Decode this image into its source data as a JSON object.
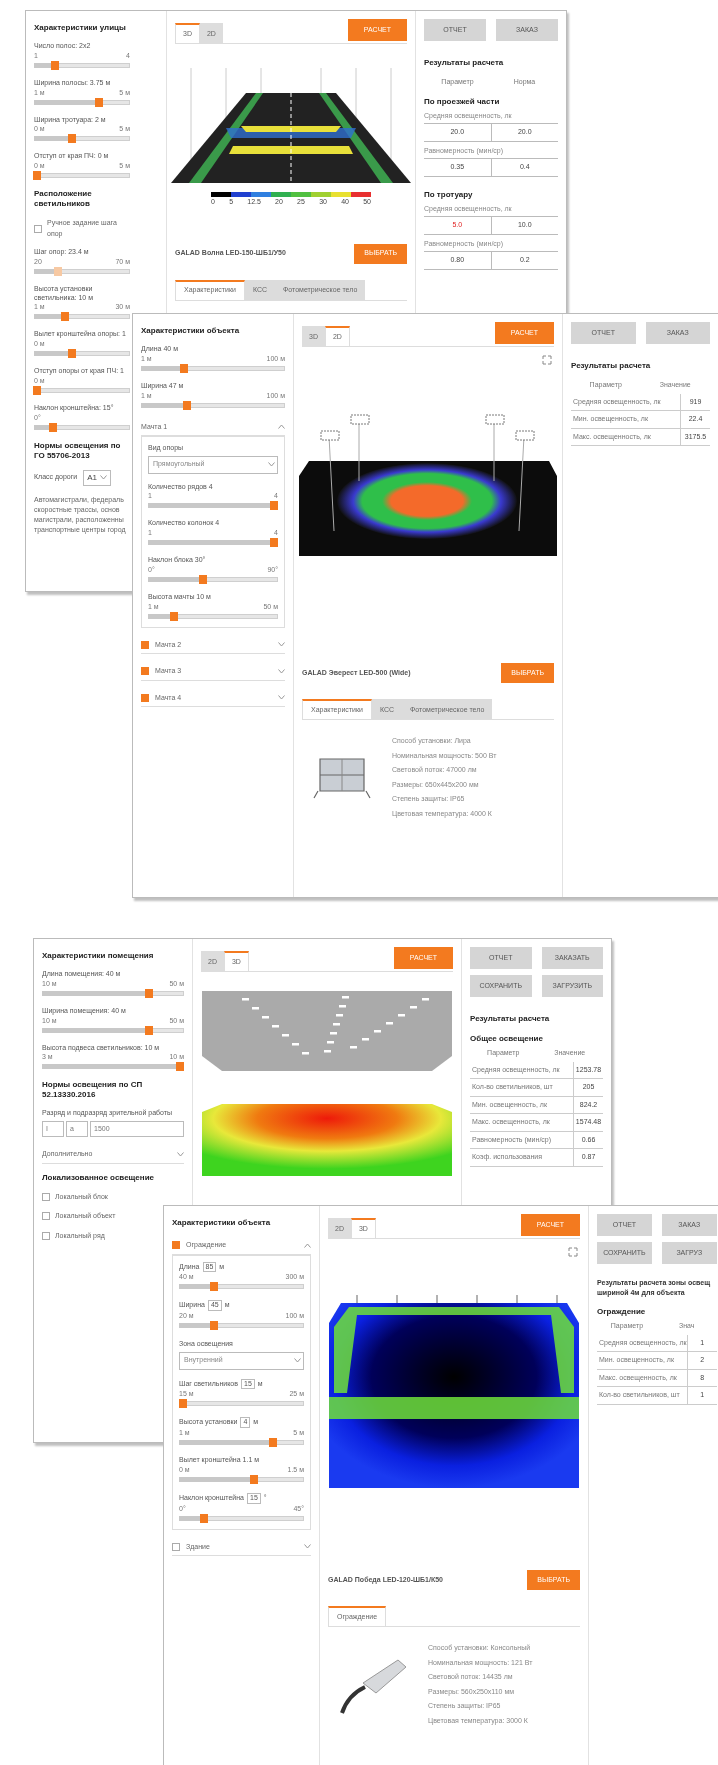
{
  "panels": [
    {
      "left": [
        {
          "kind": "heading",
          "text": "Характеристики улицы"
        },
        {
          "kind": "slider",
          "label": "Число полос: 2х2",
          "min": "1",
          "max": "4",
          "level": 0.22,
          "disabled": false
        },
        {
          "kind": "slider",
          "label": "Ширина полосы: 3.75 м",
          "min": "1 м",
          "max": "5 м",
          "level": 0.68,
          "disabled": false
        },
        {
          "kind": "slider",
          "label": "Ширина тротуара: 2 м",
          "min": "0 м",
          "max": "5 м",
          "level": 0.4,
          "disabled": false
        },
        {
          "kind": "slider",
          "label": "Отступ от края ПЧ: 0 м",
          "min": "0 м",
          "max": "5 м",
          "level": 0.03,
          "disabled": false
        },
        {
          "kind": "heading",
          "text": "Расположение светильников"
        },
        {
          "kind": "checkbox",
          "label": "Ручное задание шага опор",
          "checked": false
        },
        {
          "kind": "slider",
          "label": "Шаг опор: 23.4 м",
          "min": "20",
          "max": "70 м",
          "level": 0.25,
          "disabled": true
        },
        {
          "kind": "slider",
          "label": "Высота установки светильника: 10 м",
          "min": "1 м",
          "max": "30 м",
          "level": 0.32,
          "disabled": false
        },
        {
          "kind": "slider",
          "label": "Вылет кронштейна опоры: 1",
          "min": "0 м",
          "level": 0.4,
          "disabled": false
        },
        {
          "kind": "slider",
          "label": "Отступ опоры от края ПЧ: 1",
          "min": "0 м",
          "level": 0.03,
          "disabled": false
        },
        {
          "kind": "slider",
          "label": "Наклон кронштейна: 15°",
          "min": "0°",
          "level": 0.2,
          "disabled": false
        },
        {
          "kind": "heading",
          "text": "Нормы освещения по ГО 55706-2013"
        },
        {
          "kind": "select-inline",
          "label": "Класс дороги",
          "value": "А1"
        },
        {
          "kind": "text",
          "lines": [
            "Автомагистрали, федераль",
            "скоростные трассы, основ",
            "магистрали, расположенны",
            "транспортные центры город"
          ]
        }
      ],
      "center": {
        "view_tabs": [
          {
            "label": "3D",
            "selected": true
          },
          {
            "label": "2D",
            "selected": false
          }
        ],
        "calc_button": "РАСЧЕТ",
        "visual": {
          "kind": "road"
        },
        "scale": [
          "0",
          "5",
          "12.5",
          "20",
          "25",
          "30",
          "40",
          "50"
        ],
        "product": "GALAD Волна LED-150-ШБ1/У50",
        "select_button": "ВЫБРАТЬ",
        "info_tabs": [
          {
            "label": "Характеристики",
            "selected": true
          },
          {
            "label": "КСС",
            "selected": false
          },
          {
            "label": "Фотометрическое тело",
            "selected": false
          }
        ]
      },
      "right": {
        "buttons": [
          "ОТЧЕТ",
          "ЗАКАЗ"
        ],
        "title": "Результаты расчета",
        "header": [
          "Параметр",
          "Норма"
        ],
        "sections": [
          {
            "title": "По проезжей части",
            "rows": [
              {
                "kind": "pair",
                "label": "Средняя освещенность, лк",
                "values": [
                  {
                    "text": "20.0",
                    "alert": false
                  },
                  {
                    "text": "20.0",
                    "alert": false
                  }
                ]
              },
              {
                "kind": "pair",
                "label": "Равномерность (мин/ср)",
                "values": [
                  {
                    "text": "0.35",
                    "alert": false
                  },
                  {
                    "text": "0.4",
                    "alert": false
                  }
                ]
              }
            ]
          },
          {
            "title": "По тротуару",
            "rows": [
              {
                "kind": "pair",
                "label": "Средняя освещенность, лк",
                "values": [
                  {
                    "text": "5.0",
                    "alert": true
                  },
                  {
                    "text": "10.0",
                    "alert": false
                  }
                ]
              },
              {
                "kind": "pair",
                "label": "Равномерность (мин/ср)",
                "values": [
                  {
                    "text": "0.80",
                    "alert": false
                  },
                  {
                    "text": "0.2",
                    "alert": false
                  }
                ]
              }
            ]
          }
        ]
      }
    },
    {
      "left": [
        {
          "kind": "heading",
          "text": "Характеристики объекта"
        },
        {
          "kind": "slider",
          "label": "Длина 40 м",
          "min": "1 м",
          "max": "100 м",
          "level": 0.3
        },
        {
          "kind": "slider",
          "label": "Ширина 47 м",
          "min": "1 м",
          "max": "100 м",
          "level": 0.32
        },
        {
          "kind": "section",
          "label": "Мачта 1",
          "expanded": true,
          "children": [
            {
              "kind": "select",
              "label": "Вид опоры",
              "value": "Прямоугольный"
            },
            {
              "kind": "slider",
              "label": "Количество рядов 4",
              "min": "1",
              "max": "4",
              "level": 0.97
            },
            {
              "kind": "slider",
              "label": "Количество колонок 4",
              "min": "1",
              "max": "4",
              "level": 0.97
            },
            {
              "kind": "slider",
              "label": "Наклон блока 30°",
              "min": "0°",
              "max": "90°",
              "level": 0.42
            },
            {
              "kind": "slider",
              "label": "Высота мачты 10 м",
              "min": "1 м",
              "max": "50 м",
              "level": 0.2
            }
          ]
        },
        {
          "kind": "section",
          "label": "Мачта 2",
          "checked": true,
          "expanded": false
        },
        {
          "kind": "section",
          "label": "Мачта 3",
          "checked": true,
          "expanded": false
        },
        {
          "kind": "section",
          "label": "Мачта 4",
          "checked": true,
          "expanded": false
        }
      ],
      "center": {
        "view_tabs": [
          {
            "label": "3D",
            "selected": false
          },
          {
            "label": "2D",
            "selected": true
          }
        ],
        "calc_button": "РАСЧЕТ",
        "visual": {
          "kind": "stadium"
        },
        "product": "GALAD Эверест LED-500 (Wide)",
        "select_button": "ВЫБРАТЬ",
        "info_tabs": [
          {
            "label": "Характеристики",
            "selected": true
          },
          {
            "label": "КСС",
            "selected": false
          },
          {
            "label": "Фотометрическое тело",
            "selected": false
          }
        ],
        "lamp": {
          "kind": "floodlight"
        },
        "specs": [
          "Способ установки: Лира",
          "Номинальная мощность: 500 Вт",
          "Световой поток: 47000 лм",
          "Размеры: 650x445x200 мм",
          "Степень защиты: IP65",
          "Цветовая температура: 4000 К"
        ]
      },
      "right": {
        "buttons": [
          "ОТЧЕТ",
          "ЗАКАЗ"
        ],
        "title": "Результаты расчета",
        "sections": [
          {
            "header": [
              "Параметр",
              "Значение"
            ],
            "rows": [
              {
                "kind": "row",
                "label": "Средняя освещенность, лк",
                "value": "919"
              },
              {
                "kind": "row",
                "label": "Мин. освещенность, лк",
                "value": "22.4"
              },
              {
                "kind": "row",
                "label": "Макс. освещенность, лк",
                "value": "3175.5"
              }
            ]
          }
        ]
      }
    },
    {
      "left": [
        {
          "kind": "heading",
          "text": "Характеристики помещения"
        },
        {
          "kind": "slider",
          "label": "Длина помещения: 40 м",
          "min": "10 м",
          "max": "50 м",
          "level": 0.75
        },
        {
          "kind": "slider",
          "label": "Ширина помещения: 40 м",
          "min": "10 м",
          "max": "50 м",
          "level": 0.75
        },
        {
          "kind": "slider",
          "label": "Высота подвеса светильников: 10 м",
          "min": "3 м",
          "max": "10 м",
          "level": 0.97
        },
        {
          "kind": "heading",
          "text": "Нормы освещения по СП 52.13330.2016"
        },
        {
          "kind": "inputs",
          "label": "Разряд и подразряд зрительной работы",
          "values": [
            "I",
            "а",
            "1500"
          ]
        },
        {
          "kind": "section",
          "label": "Дополнительно",
          "expanded": false
        },
        {
          "kind": "heading",
          "text": "Локализованное освещение"
        },
        {
          "kind": "checkbox",
          "label": "Локальный блок",
          "checked": false
        },
        {
          "kind": "checkbox",
          "label": "Локальный объект",
          "checked": false
        },
        {
          "kind": "checkbox",
          "label": "Локальный ряд",
          "checked": false
        }
      ],
      "center": {
        "view_tabs": [
          {
            "label": "2D",
            "selected": false
          },
          {
            "label": "3D",
            "selected": true
          }
        ],
        "calc_button": "РАСЧЕТ",
        "visual": {
          "kind": "warehouse"
        }
      },
      "right": {
        "buttons": [
          "ОТЧЕТ",
          "ЗАКАЗАТЬ",
          "СОХРАНИТЬ",
          "ЗАГРУЗИТЬ"
        ],
        "title": "Результаты расчета",
        "sections": [
          {
            "title": "Общее освещение",
            "header": [
              "Параметр",
              "Значение"
            ],
            "rows": [
              {
                "kind": "row",
                "label": "Средняя освещенность, лк",
                "value": "1253.78"
              },
              {
                "kind": "row",
                "label": "Кол-во светильников, шт",
                "value": "205"
              },
              {
                "kind": "row",
                "label": "Мин. освещенность, лк",
                "value": "824.2"
              },
              {
                "kind": "row",
                "label": "Макс. освещенность, лк",
                "value": "1574.48"
              },
              {
                "kind": "row",
                "label": "Равномерность (мин/ср)",
                "value": "0.66"
              },
              {
                "kind": "row",
                "label": "Коэф. использования",
                "value": "0.87"
              }
            ]
          }
        ]
      }
    },
    {
      "left": [
        {
          "kind": "heading",
          "text": "Характеристики объекта"
        },
        {
          "kind": "section",
          "label": "Ограждение",
          "checked": true,
          "expanded": true,
          "children": [
            {
              "kind": "slider",
              "label": "Длина",
              "field": "85",
              "unit": "м",
              "min": "40 м",
              "max": "300 м",
              "level": 0.28
            },
            {
              "kind": "slider",
              "label": "Ширина",
              "field": "45",
              "unit": "м",
              "min": "20 м",
              "max": "100 м",
              "level": 0.28
            },
            {
              "kind": "select",
              "label": "Зона освещения",
              "value": "Внутренний"
            },
            {
              "kind": "slider",
              "label": "Шаг светильников",
              "field": "15",
              "unit": "м",
              "min": "15 м",
              "max": "25 м",
              "level": 0.03
            },
            {
              "kind": "slider",
              "label": "Высота установки",
              "field": "4",
              "unit": "м",
              "min": "1 м",
              "max": "5 м",
              "level": 0.75
            },
            {
              "kind": "slider",
              "label": "Вылет кронштейна 1.1 м",
              "min": "0 м",
              "max": "1.5 м",
              "level": 0.6
            },
            {
              "kind": "slider",
              "label": "Наклон кронштейна",
              "field": "15",
              "unit": "°",
              "min": "0°",
              "max": "45°",
              "level": 0.2
            }
          ]
        },
        {
          "kind": "section",
          "label": "Здание",
          "checked": false,
          "expanded": false
        }
      ],
      "center": {
        "view_tabs": [
          {
            "label": "2D",
            "selected": false
          },
          {
            "label": "3D",
            "selected": true
          }
        ],
        "calc_button": "РАСЧЕТ",
        "visual": {
          "kind": "fence"
        },
        "product": "GALAD Победа LED-120-ШБ1/К50",
        "select_button": "ВЫБРАТЬ",
        "info_tabs": [
          {
            "label": "Ограждение",
            "selected": true
          }
        ],
        "lamp": {
          "kind": "streetlight"
        },
        "specs": [
          "Способ установки: Консольный",
          "Номинальная мощность: 121 Вт",
          "Световой поток: 14435 лм",
          "Размеры: 560х250х110 мм",
          "Степень защиты: IP65",
          "Цветовая температура: 3000 К"
        ]
      },
      "right": {
        "buttons": [
          "ОТЧЕТ",
          "ЗАКАЗ",
          "СОХРАНИТЬ",
          "ЗАГРУЗ"
        ],
        "note": [
          "Результаты расчета зоны освещ",
          "шириной 4м для объекта"
        ],
        "sections": [
          {
            "title": "Ограждение",
            "header": [
              "Параметр",
              "Знач"
            ],
            "rows": [
              {
                "kind": "row",
                "label": "Средняя освещенность, лк",
                "value": "1"
              },
              {
                "kind": "row",
                "label": "Мин. освещенность, лк",
                "value": "2"
              },
              {
                "kind": "row",
                "label": "Макс. освещенность, лк",
                "value": "8"
              },
              {
                "kind": "row",
                "label": "Кол-во светильников, шт",
                "value": "1"
              }
            ]
          }
        ]
      }
    }
  ]
}
